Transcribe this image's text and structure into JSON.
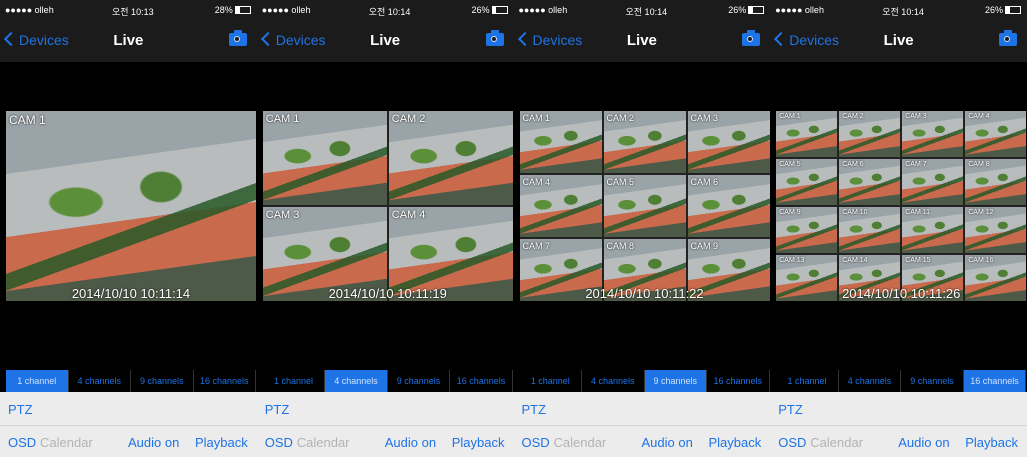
{
  "colors": {
    "accent": "#1e73e6",
    "bar_bg": "#1b1b1b",
    "toolbar_bg": "#ececec",
    "disabled_text": "#b3b3b3"
  },
  "tab_labels": [
    "1 channel",
    "4 channels",
    "9 channels",
    "16 channels"
  ],
  "panels": [
    {
      "status": {
        "carrier": "●●●●● olleh",
        "time": "오전 10:13",
        "battery": "28%",
        "battery_level": 0.28
      },
      "nav": {
        "back_label": "Devices",
        "title": "Live",
        "camera_icon": "camera-icon"
      },
      "grid_cols": 1,
      "cameras": [
        "CAM 1"
      ],
      "timestamp": "2014/10/10 10:11:14",
      "active_tab": 0,
      "toolbar": {
        "ptz": "PTZ",
        "osd": "OSD",
        "calendar": "Calendar",
        "audio": "Audio on",
        "playback": "Playback"
      }
    },
    {
      "status": {
        "carrier": "●●●●● olleh",
        "time": "오전 10:14",
        "battery": "26%",
        "battery_level": 0.26
      },
      "nav": {
        "back_label": "Devices",
        "title": "Live",
        "camera_icon": "camera-icon"
      },
      "grid_cols": 2,
      "cameras": [
        "CAM 1",
        "CAM 2",
        "CAM 3",
        "CAM 4"
      ],
      "timestamp": "2014/10/10 10:11:19",
      "active_tab": 1,
      "toolbar": {
        "ptz": "PTZ",
        "osd": "OSD",
        "calendar": "Calendar",
        "audio": "Audio on",
        "playback": "Playback"
      }
    },
    {
      "status": {
        "carrier": "●●●●● olleh",
        "time": "오전 10:14",
        "battery": "26%",
        "battery_level": 0.26
      },
      "nav": {
        "back_label": "Devices",
        "title": "Live",
        "camera_icon": "camera-icon"
      },
      "grid_cols": 3,
      "cameras": [
        "CAM 1",
        "CAM 2",
        "CAM 3",
        "CAM 4",
        "CAM 5",
        "CAM 6",
        "CAM 7",
        "CAM 8",
        "CAM 9"
      ],
      "timestamp": "2014/10/10 10:11:22",
      "active_tab": 2,
      "toolbar": {
        "ptz": "PTZ",
        "osd": "OSD",
        "calendar": "Calendar",
        "audio": "Audio on",
        "playback": "Playback"
      }
    },
    {
      "status": {
        "carrier": "●●●●● olleh",
        "time": "오전 10:14",
        "battery": "26%",
        "battery_level": 0.26
      },
      "nav": {
        "back_label": "Devices",
        "title": "Live",
        "camera_icon": "camera-icon"
      },
      "grid_cols": 4,
      "cameras": [
        "CAM 1",
        "CAM 2",
        "CAM 3",
        "CAM 4",
        "CAM 5",
        "CAM 6",
        "CAM 7",
        "CAM 8",
        "CAM 9",
        "CAM 10",
        "CAM 11",
        "CAM 12",
        "CAM 13",
        "CAM 14",
        "CAM 15",
        "CAM 16"
      ],
      "timestamp": "2014/10/10 10:11:26",
      "active_tab": 3,
      "toolbar": {
        "ptz": "PTZ",
        "osd": "OSD",
        "calendar": "Calendar",
        "audio": "Audio on",
        "playback": "Playback"
      }
    }
  ]
}
